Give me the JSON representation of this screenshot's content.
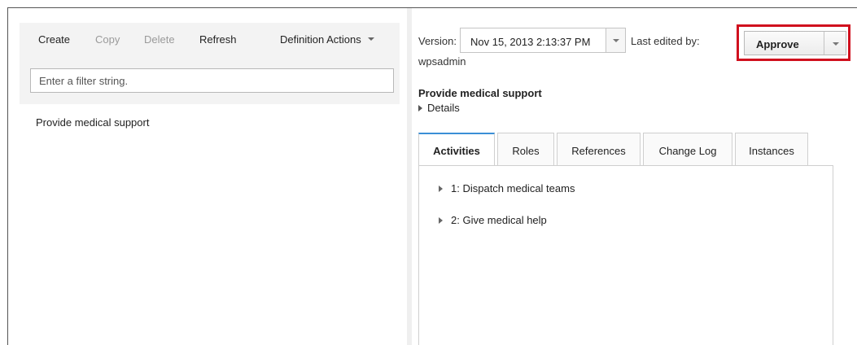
{
  "toolbar": {
    "create": "Create",
    "copy": "Copy",
    "delete": "Delete",
    "refresh": "Refresh",
    "definition_actions": "Definition Actions"
  },
  "filter": {
    "placeholder": "Enter a filter string."
  },
  "tree": {
    "items": [
      "Provide medical support"
    ]
  },
  "version": {
    "label": "Version:",
    "selected": "Nov 15, 2013 2:13:37 PM",
    "last_edited_label": "Last edited by:",
    "last_edited_user": "wpsadmin"
  },
  "approve_button": "Approve",
  "definition": {
    "title": "Provide medical support",
    "details_label": "Details"
  },
  "tabs": [
    {
      "label": "Activities",
      "active": true
    },
    {
      "label": "Roles",
      "active": false
    },
    {
      "label": "References",
      "active": false
    },
    {
      "label": "Change Log",
      "active": false
    },
    {
      "label": "Instances",
      "active": false
    }
  ],
  "activities": [
    "1: Dispatch medical teams",
    "2: Give medical help"
  ],
  "colors": {
    "highlight": "#d0101e",
    "active_tab_accent": "#3b8fd6",
    "toolbar_bg": "#f3f3f3"
  }
}
